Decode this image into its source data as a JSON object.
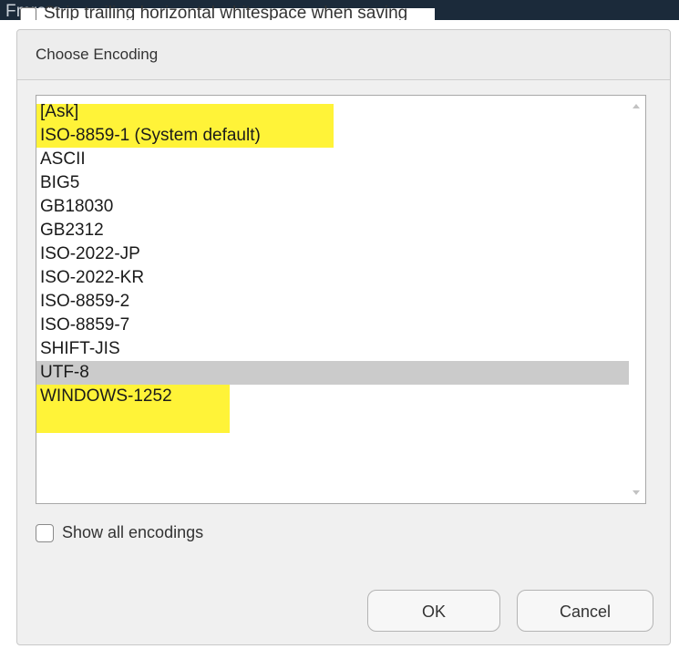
{
  "background": {
    "partial_title": "Fmrars",
    "partial_option": "Strip trailing horizontal whitespace when saving"
  },
  "dialog": {
    "title": "Choose Encoding",
    "encodings": [
      "[Ask]",
      "ISO-8859-1 (System default)",
      "ASCII",
      "BIG5",
      "GB18030",
      "GB2312",
      "ISO-2022-JP",
      "ISO-2022-KR",
      "ISO-8859-2",
      "ISO-8859-7",
      "SHIFT-JIS",
      "UTF-8",
      "WINDOWS-1252"
    ],
    "selected_encoding": "UTF-8",
    "highlighted_encodings": [
      "ISO-8859-1 (System default)",
      "ASCII",
      "SHIFT-JIS",
      "UTF-8"
    ],
    "show_all_label": "Show all encodings",
    "show_all_checked": false,
    "ok_label": "OK",
    "cancel_label": "Cancel"
  },
  "colors": {
    "selection": "#cbcbcb",
    "highlighter": "#fff000",
    "dialog_bg": "#f0f0f0"
  },
  "icons": [
    "scroll-up-arrow-icon",
    "scroll-down-arrow-icon"
  ]
}
